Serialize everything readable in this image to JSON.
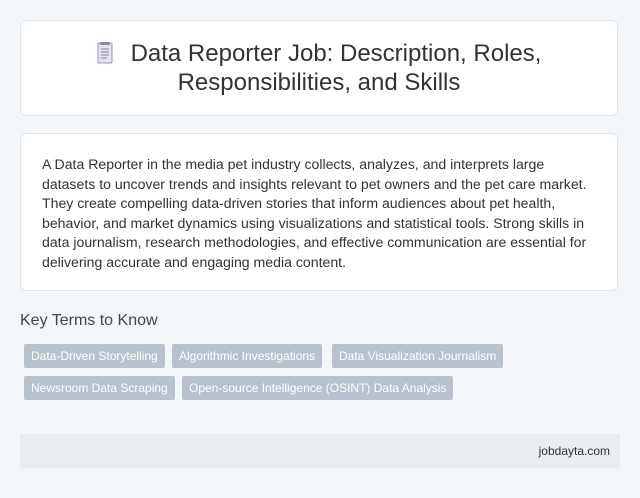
{
  "header": {
    "icon": "document-icon",
    "title": "Data Reporter Job: Description, Roles, Responsibilities, and Skills"
  },
  "description": {
    "text": "A Data Reporter in the media pet industry collects, analyzes, and interprets large datasets to uncover trends and insights relevant to pet owners and the pet care market. They create compelling data-driven stories that inform audiences about pet health, behavior, and market dynamics using visualizations and statistical tools. Strong skills in data journalism, research methodologies, and effective communication are essential for delivering accurate and engaging media content."
  },
  "key_terms": {
    "heading": "Key Terms to Know",
    "tags": [
      "Data-Driven Storytelling",
      "Algorithmic Investigations",
      "Data Visualization Journalism",
      "Newsroom Data Scraping",
      "Open-source Intelligence (OSINT) Data Analysis"
    ]
  },
  "footer": {
    "site": "jobdayta.com"
  },
  "colors": {
    "background": "#f4f7fa",
    "tag": "#b9c2cc",
    "footer": "#e8eef0"
  }
}
